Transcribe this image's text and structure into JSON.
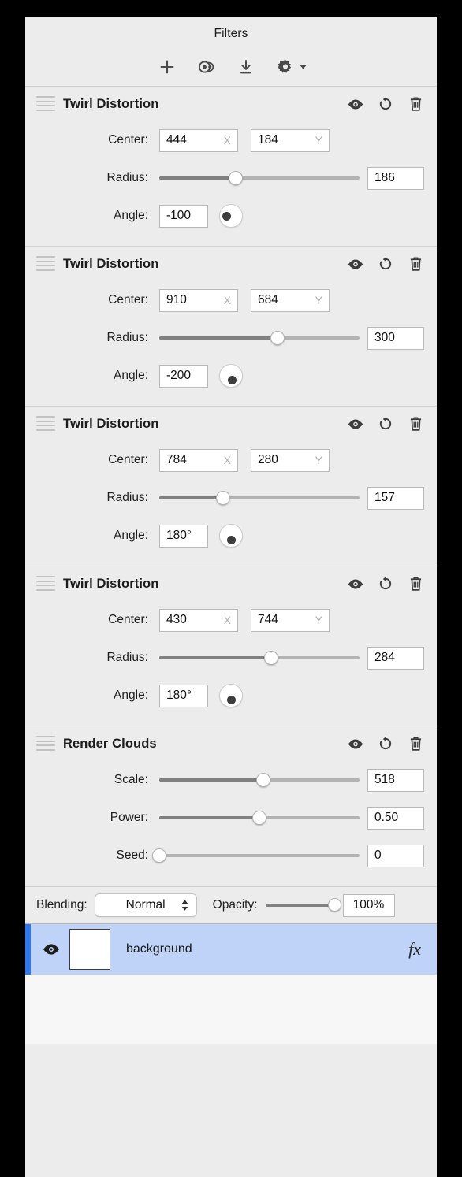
{
  "panel": {
    "title": "Filters",
    "toolbar": [
      {
        "icon": "plus-icon",
        "name": "add-filter-button"
      },
      {
        "icon": "clone-icon",
        "name": "duplicate-filter-button"
      },
      {
        "icon": "download-icon",
        "name": "import-filter-button"
      },
      {
        "icon": "gear-icon",
        "name": "filter-settings-button"
      }
    ]
  },
  "header_actions": {
    "visibility": "eye-icon",
    "reset": "reset-rotate-icon",
    "delete": "trash-icon"
  },
  "labels": {
    "center": "Center:",
    "radius": "Radius:",
    "angle": "Angle:",
    "scale": "Scale:",
    "power": "Power:",
    "seed": "Seed:",
    "axis_x": "X",
    "axis_y": "Y"
  },
  "filters": [
    {
      "name": "Twirl Distortion",
      "center_x": "444",
      "center_y": "184",
      "radius": "186",
      "radius_pct": 38,
      "angle": "-100",
      "angle_deg": -100
    },
    {
      "name": "Twirl Distortion",
      "center_x": "910",
      "center_y": "684",
      "radius": "300",
      "radius_pct": 59,
      "angle": "-200",
      "angle_deg": -200
    },
    {
      "name": "Twirl Distortion",
      "center_x": "784",
      "center_y": "280",
      "radius": "157",
      "radius_pct": 32,
      "angle": "180°",
      "angle_deg": 180
    },
    {
      "name": "Twirl Distortion",
      "center_x": "430",
      "center_y": "744",
      "radius": "284",
      "radius_pct": 56,
      "angle": "180°",
      "angle_deg": 180
    }
  ],
  "clouds": {
    "name": "Render Clouds",
    "scale": "518",
    "scale_pct": 52,
    "power": "0.50",
    "power_pct": 50,
    "seed": "0",
    "seed_pct": 0
  },
  "blending": {
    "label": "Blending:",
    "value": "Normal",
    "options": [
      "Normal"
    ],
    "opacity_label": "Opacity:",
    "opacity_value": "100%",
    "opacity_pct": 100
  },
  "layer": {
    "name": "background",
    "fx_label": "fx",
    "visible_icon": "eye-icon",
    "selected": true,
    "accent_color": "#2f78f0",
    "row_color": "#bed3f7"
  }
}
